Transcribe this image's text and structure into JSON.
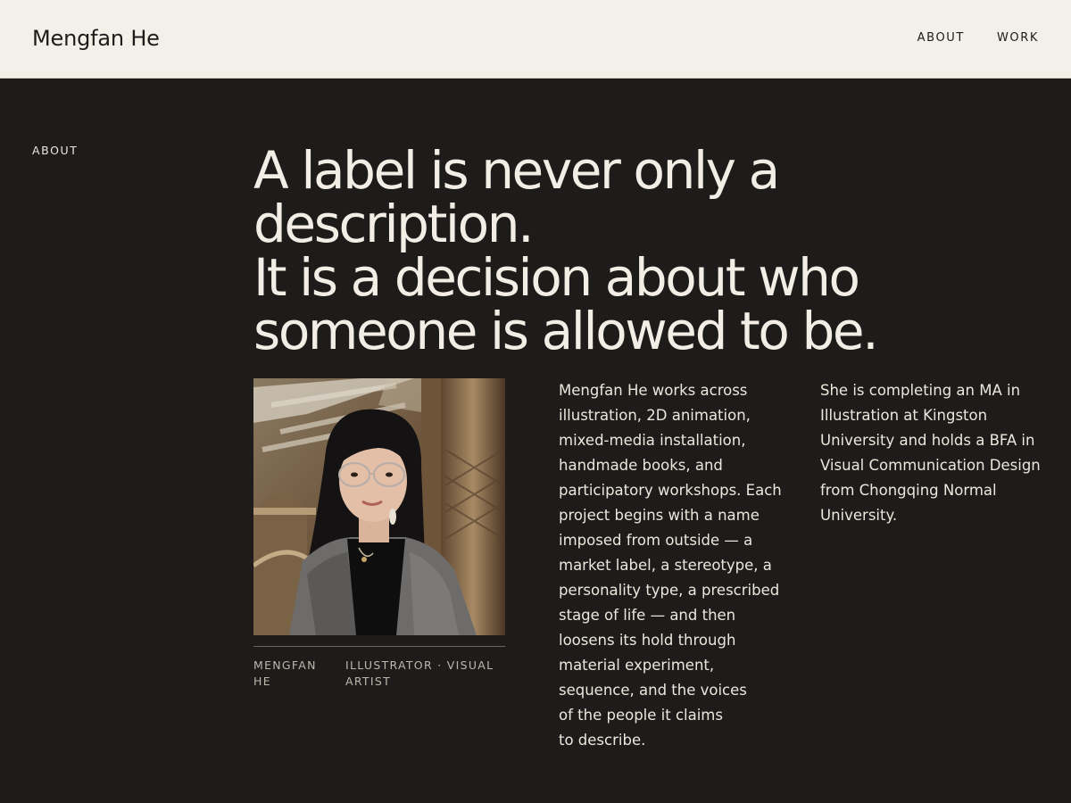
{
  "header": {
    "site_title": "Mengfan He",
    "nav": [
      {
        "label": "ABOUT"
      },
      {
        "label": "WORK"
      }
    ]
  },
  "section_label": "ABOUT",
  "headline": {
    "lines": [
      "A label is never only a description.",
      "It is a decision about who",
      "someone is allowed to be."
    ]
  },
  "portrait": {
    "alt": "Portrait of Mengfan He"
  },
  "caption": {
    "name": "MENGFAN HE",
    "role": "ILLUSTRATOR · VISUAL ARTIST"
  },
  "bio": {
    "column1_lines": [
      "Mengfan He works across",
      "illustration, 2D animation,",
      "mixed-media installation,",
      "handmade books, and",
      "participatory workshops. Each",
      "project begins with a name",
      "imposed from outside — a",
      "market label, a stereotype, a",
      "personality type, a prescribed",
      "stage of life — and then",
      "loosens its hold through",
      "material experiment,",
      "sequence, and the voices",
      "of the people it claims",
      "to describe."
    ],
    "column2_lines": [
      "She is completing an MA in",
      "Illustration at Kingston",
      "University and holds a BFA in",
      "Visual Communication Design",
      "from Chongqing Normal",
      "University."
    ]
  },
  "colors": {
    "header_bg": "#f3f0e9",
    "page_bg": "#1e1c1b",
    "text_light": "#f3eee5",
    "caption_text": "#bdb6ab"
  }
}
